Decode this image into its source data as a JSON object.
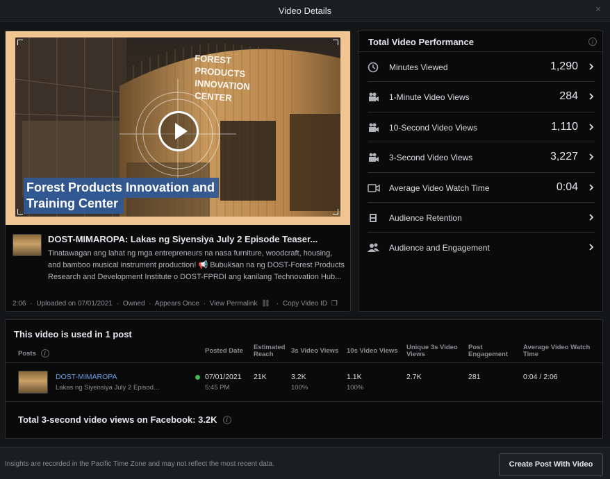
{
  "window": {
    "title": "Video Details",
    "close_icon": "×"
  },
  "video": {
    "overlay_line1": "Forest Products Innovation and",
    "overlay_line2": "Training Center",
    "building_sign": [
      "FOREST",
      "PRODUCTS",
      "INNOVATION",
      "CENTER"
    ],
    "post_title": "DOST-MIMAROPA: Lakas ng Siyensiya July 2 Episode Teaser...",
    "post_desc": "Tinatawagan ang lahat ng mga entrepreneurs na nasa furniture, woodcraft, housing, and bamboo musical instrument production! 📢 Bubuksan na ng DOST-Forest Products Research and Development Institute o DOST-FPRDI ang kanilang Technovation Hub...",
    "meta": {
      "duration": "2:06",
      "uploaded": "Uploaded on 07/01/2021",
      "owned": "Owned",
      "appears": "Appears Once",
      "permalink": "View Permalink",
      "copy_id": "Copy Video ID",
      "sep": "·"
    }
  },
  "performance": {
    "title": "Total Video Performance",
    "rows": [
      {
        "label": "Minutes Viewed",
        "value": "1,290",
        "icon": "clock-icon"
      },
      {
        "label": "1-Minute Video Views",
        "value": "284",
        "icon": "camera-icon"
      },
      {
        "label": "10-Second Video Views",
        "value": "1,110",
        "icon": "camera-icon"
      },
      {
        "label": "3-Second Video Views",
        "value": "3,227",
        "icon": "camera-icon"
      },
      {
        "label": "Average Video Watch Time",
        "value": "0:04",
        "icon": "video-icon"
      },
      {
        "label": "Audience Retention",
        "value": "",
        "icon": "film-icon"
      },
      {
        "label": "Audience and Engagement",
        "value": "",
        "icon": "people-icon"
      }
    ]
  },
  "used": {
    "title": "This video is used in 1 post",
    "headers": {
      "posts": "Posts",
      "posted_date": "Posted Date",
      "estimated_reach": [
        "Estimated",
        "Reach"
      ],
      "views_3s": "3s Video Views",
      "views_10s": "10s Video Views",
      "unique_3s": [
        "Unique 3s Video",
        "Views"
      ],
      "engagement": [
        "Post",
        "Engagement"
      ],
      "avg_watch": [
        "Average Video Watch",
        "Time"
      ]
    },
    "row": {
      "page": "DOST-MIMAROPA",
      "caption": "Lakas ng Siyensiya July 2 Episod...",
      "date": "07/01/2021",
      "time": "5:45 PM",
      "reach": "21K",
      "views_3s": "3.2K",
      "views_3s_pct": "100%",
      "views_10s": "1.1K",
      "views_10s_pct": "100%",
      "unique_3s": "2.7K",
      "engagement": "281",
      "avg_watch": "0:04 / 2:06"
    },
    "total": "Total 3-second video views on Facebook: 3.2K"
  },
  "footer": {
    "note": "Insights are recorded in the Pacific Time Zone and may not reflect the most recent data.",
    "button": "Create Post With Video"
  },
  "colors": {
    "accent_link": "#6a9ee8",
    "status_green": "#3fb950",
    "thumb_frame": "#f0c592",
    "overlay_blue": "#305896"
  }
}
